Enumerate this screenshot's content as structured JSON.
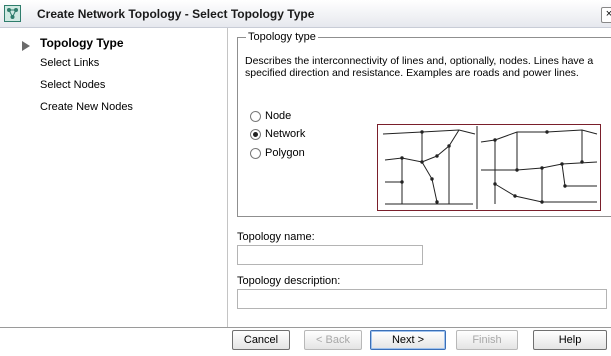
{
  "window": {
    "title": "Create Network Topology - Select Topology Type",
    "close_glyph": "×"
  },
  "nav": {
    "items": [
      {
        "label": "Topology Type",
        "active": true
      },
      {
        "label": "Select Links",
        "active": false
      },
      {
        "label": "Select Nodes",
        "active": false
      },
      {
        "label": "Create New Nodes",
        "active": false
      }
    ]
  },
  "topology_type": {
    "legend": "Topology type",
    "description": "Describes the interconnectivity of lines and, optionally, nodes. Lines have a specified direction and resistance. Examples are roads and power lines.",
    "options": [
      {
        "label": "Node",
        "selected": false
      },
      {
        "label": "Network",
        "selected": true
      },
      {
        "label": "Polygon",
        "selected": false
      }
    ],
    "diagram_colors": {
      "border": "#7a1f2b",
      "line": "#222222"
    }
  },
  "form": {
    "name_label": "Topology name:",
    "name_value": "",
    "description_label": "Topology description:",
    "description_value": ""
  },
  "buttons": {
    "cancel": "Cancel",
    "back": "< Back",
    "next": "Next >",
    "finish": "Finish",
    "help": "Help"
  },
  "icons": {
    "app": "network-topology-icon",
    "active_step": "triangle-right-icon",
    "close": "close-icon"
  }
}
